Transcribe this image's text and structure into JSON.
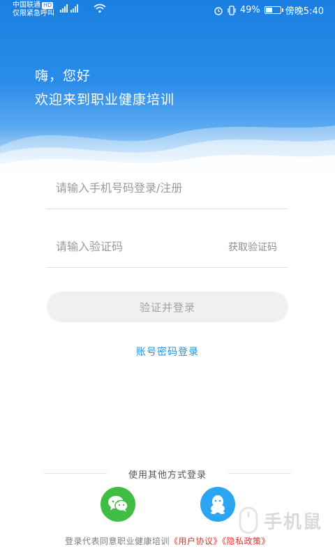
{
  "statusbar": {
    "carrier": "中国联通",
    "carrier_badge": "HD",
    "emergency": "仅限紧急呼叫",
    "battery": "49%",
    "battery_level": 0.49,
    "time": "傍晚5:40"
  },
  "header": {
    "greeting": "嗨，您好",
    "welcome": "欢迎来到职业健康培训"
  },
  "form": {
    "phone_placeholder": "请输入手机号码登录/注册",
    "code_placeholder": "请输入验证码",
    "get_code_label": "获取验证码",
    "submit_label": "验证并登录",
    "password_login_label": "账号密码登录"
  },
  "other_login": {
    "label": "使用其他方式登录",
    "methods": [
      "wechat-icon",
      "qq-icon"
    ]
  },
  "agreement": {
    "prefix": "登录代表同意职业健康培训",
    "user_agreement": "《用户协议》",
    "privacy_policy": "《隐私政策》"
  },
  "watermark": {
    "text": "手机鼠"
  },
  "colors": {
    "primary_blue": "#1a7fe0",
    "link_blue": "#2196d8",
    "wechat_green": "#3fbd45",
    "qq_blue": "#2ba4f2",
    "agreement_red": "#e0312f"
  }
}
